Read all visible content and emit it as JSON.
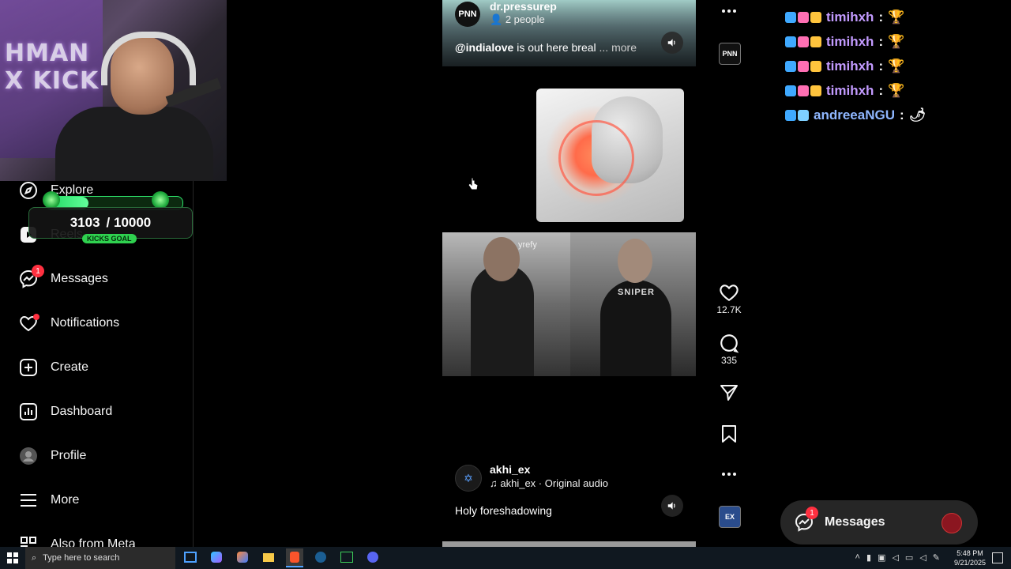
{
  "goal": {
    "current": "3103",
    "target": "/ 10000",
    "label": "KICKS GOAL",
    "progress": 0.3103,
    "banner": "HMAN X KICK"
  },
  "sidebar": {
    "items": [
      {
        "label": "Explore",
        "icon": "compass-icon"
      },
      {
        "label": "Reels",
        "icon": "reels-icon"
      },
      {
        "label": "Messages",
        "icon": "messenger-icon",
        "badge": "1"
      },
      {
        "label": "Notifications",
        "icon": "heart-icon"
      },
      {
        "label": "Create",
        "icon": "plus-square-icon"
      },
      {
        "label": "Dashboard",
        "icon": "dashboard-icon"
      },
      {
        "label": "Profile",
        "icon": "avatar-icon"
      },
      {
        "label": "More",
        "icon": "hamburger-icon"
      },
      {
        "label": "Also from Meta",
        "icon": "meta-grid-icon"
      }
    ]
  },
  "reel1": {
    "avatar": "PNN",
    "handle": "dr.pressurep",
    "people": "2 people",
    "caption_mention": "@indialove",
    "caption_text": " is out here breal",
    "caption_more": "... more"
  },
  "reel2": {
    "shirt_text": "SNIPER",
    "sign_text": "yrefy",
    "handle": "akhi_ex",
    "audio": "akhi_ex · Original audio",
    "caption": "Holy foreshadowing"
  },
  "actions": {
    "likes": "12.7K",
    "comments": "335",
    "thumb_top": "PNN",
    "thumb_bottom": "EX"
  },
  "chat": [
    {
      "user": "timihxh",
      "color": "#c39bff",
      "msg": "🏆"
    },
    {
      "user": "timihxh",
      "color": "#c39bff",
      "msg": "🏆"
    },
    {
      "user": "timihxh",
      "color": "#c39bff",
      "msg": "🏆"
    },
    {
      "user": "timihxh",
      "color": "#c39bff",
      "msg": "🏆"
    },
    {
      "user": "andreeaNGU",
      "color": "#8fb7ff",
      "msg": "🌶"
    }
  ],
  "messages_pill": {
    "label": "Messages",
    "badge": "1"
  },
  "taskbar": {
    "search_placeholder": "Type here to search",
    "time": "5:48 PM",
    "date": "9/21/2025"
  }
}
